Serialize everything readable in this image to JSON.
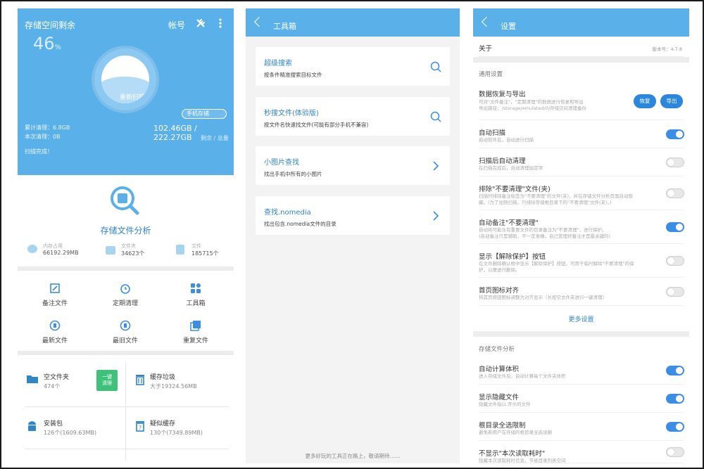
{
  "left": {
    "storage": {
      "title": "存储空间剩余",
      "account": "帐号",
      "percent": "46",
      "percent_unit": "%",
      "rescan": "重新扫描",
      "phone_storage": "手机存储",
      "total_cleaned": "累计清理：6.8GB",
      "this_cleaned": "本次清理：0B",
      "capacity": "102.46GB / 222.27GB",
      "capacity_label": "剩余 / 总量",
      "scan_done": "扫描完成！"
    },
    "analysis": {
      "title": "存储文件分析",
      "stats": [
        {
          "label": "内存占用",
          "value": "66192.29MB"
        },
        {
          "label": "文件夹",
          "value": "34623个"
        },
        {
          "label": "文件",
          "value": "185715个"
        }
      ]
    },
    "grid": [
      {
        "label": "备注文件",
        "icon": "edit-icon"
      },
      {
        "label": "定期清理",
        "icon": "alarm-clock-icon"
      },
      {
        "label": "工具箱",
        "icon": "toolbox-icon"
      },
      {
        "label": "最新文件",
        "icon": "new-file-icon"
      },
      {
        "label": "最旧文件",
        "icon": "old-file-icon"
      },
      {
        "label": "重复文件",
        "icon": "duplicate-icon"
      }
    ],
    "cards": {
      "empty_folder": {
        "title": "空文件夹",
        "sub": "474个"
      },
      "one_click_clean": "一键\n清理",
      "cache": {
        "title": "缓存垃圾",
        "sub": "大于19324.56MB"
      },
      "apk": {
        "title": "安装包",
        "sub": "126个(1609.63MB)"
      },
      "suspect_cache": {
        "title": "疑似缓存",
        "sub": "130个(7349.89MB)"
      }
    }
  },
  "middle": {
    "title": "工具箱",
    "tools": [
      {
        "title": "超级搜索",
        "desc": "按条件精准搜索目标文件",
        "icon": "search-icon"
      },
      {
        "title": "秒搜文件(体验版)",
        "desc": "按文件名快速找文件(可能有部分手机不兼容)",
        "icon": "search-icon"
      },
      {
        "title": "小图片查找",
        "desc": "找出手机中所有的小图片",
        "icon": "chevron-right-icon"
      },
      {
        "title": "查找.nomedia",
        "desc": "找出包含.nomedia文件的目录",
        "icon": "chevron-right-icon"
      }
    ],
    "footer": "更多好玩的工具正在路上，敬请期待……"
  },
  "right": {
    "title": "设置",
    "about": "关于",
    "version": "版本号：4.7.8",
    "general": "通用设置",
    "data_recovery": {
      "title": "数据恢复与导出",
      "desc": "可对\"文件备注\"，\"定期清理\"的数据进行恢复和导出\n导出路径：/storage/emulated/0/存储空间清理备份",
      "restore": "恢复",
      "export": "导出"
    },
    "settings": [
      {
        "title": "自动扫描",
        "desc": "启动软件后，自动进行扫描",
        "on": true
      },
      {
        "title": "扫描后自动清理",
        "desc": "在扫描完成后，自动清理指定项",
        "on": false
      },
      {
        "title": "排除\"不要清理\"文件(夹)",
        "desc": "扫描时排除备注标签为\"不要清理\"的文件(夹)，并在存储文件分析页面自动隐藏。(为了加快扫描，只排除存储根目录下的\"不要清理\"文件(夹)。)",
        "on": false
      },
      {
        "title": "自动备注\"不要清理\"",
        "desc": "自动将可能含有重要文件的目录备注为\"不要清理\"，进行保护。\n(自动备注只是辅助，不一定准确，自己管理好备注才是最关键的)",
        "on": true
      },
      {
        "title": "显示【解除保护】按钮",
        "desc": "在文件删除确认框中显示【解除保护】按钮，可用于临时解除\"不要清理\"的保护，以便进行删除。",
        "on": false
      },
      {
        "title": "首页图标对齐",
        "desc": "将首页按钮图标调整为对齐显示（长按空文件夹进行一键清理）",
        "on": false
      }
    ],
    "more": "更多设置",
    "analysis_section": "存储文件分析",
    "analysis_settings": [
      {
        "title": "自动计算体积",
        "desc": "进入存储文件后，自动计算每个文件夹体积",
        "on": true
      },
      {
        "title": "显示隐藏文件",
        "desc": "隐藏文件指以.开头的文件",
        "on": true
      },
      {
        "title": "根目录全选限制",
        "desc": "避免新用户在存储的根目录全选误删",
        "on": true
      },
      {
        "title": "不显示\"本次读取耗时\"",
        "desc": "隐藏本次读取耗时信息，节省目录列表空间",
        "on": false
      }
    ]
  },
  "colors": {
    "accent": "#5ab1ea",
    "toggle_on": "#3a8ee6",
    "green": "#3fc17a"
  }
}
